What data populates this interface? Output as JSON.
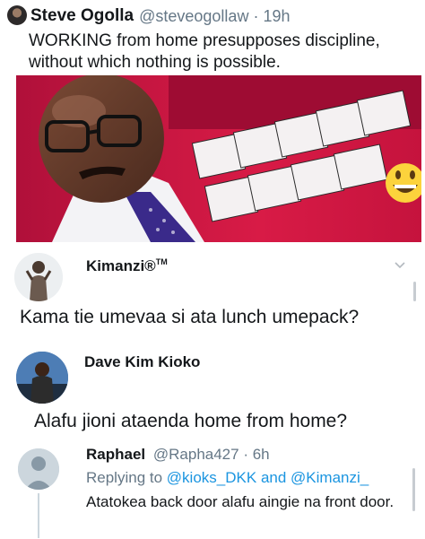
{
  "tweet": {
    "name": "Steve Ogolla",
    "handle": "@steveogollaw",
    "time": "· 19h",
    "text": "WORKING from home presupposes discipline, without which nothing is possible."
  },
  "reply1": {
    "name": "Kimanzi®",
    "name_mark": "TM",
    "text": "Kama tie umevaa si ata lunch umepack?"
  },
  "reply2": {
    "name": "Dave Kim Kioko",
    "text": "Alafu jioni ataenda home from home?"
  },
  "reply3": {
    "name": "Raphael",
    "handle": "@Rapha427",
    "time": "· 6h",
    "replying_prefix": "Replying to",
    "mention1": "@kioks_DKK",
    "and_word": "and",
    "mention2": "@Kimanzi_",
    "text": "Atatokea back door alafu aingie na front door."
  },
  "colors": {
    "text": "#14171a",
    "secondary": "#657786",
    "link": "#1b95e0",
    "photo_background": "#c8133a"
  },
  "icons": [
    "chevron-down-icon",
    "grinning-emoji-icon",
    "default-avatar-icon"
  ]
}
